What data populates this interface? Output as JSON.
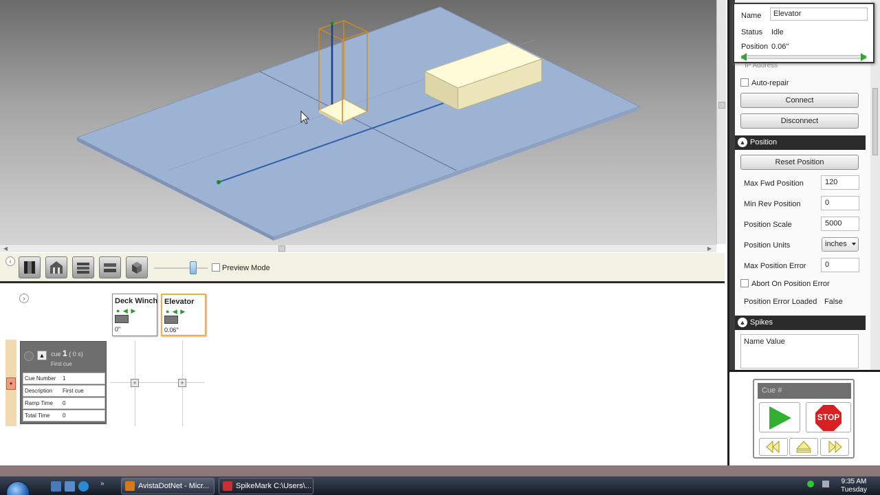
{
  "viewport": {
    "cursor": "arrow-cursor"
  },
  "toolbar": {
    "buttons": [
      "curtain-view-button",
      "house-view-button",
      "stack-view-button",
      "stack-alt-view-button",
      "iso-view-button"
    ],
    "preview_mode_label": "Preview Mode",
    "preview_mode_checked": false
  },
  "axes": [
    {
      "name": "Deck Winch",
      "value": "0\""
    },
    {
      "name": "Elevator",
      "value": "0.06\""
    }
  ],
  "cue": {
    "header_prefix": "cue",
    "number": "1",
    "time": "( 0 s)",
    "subtitle": "First cue",
    "fields": [
      {
        "label": "Cue Number",
        "value": "1"
      },
      {
        "label": "Description",
        "value": "First cue"
      },
      {
        "label": "Ramp Time",
        "value": "0"
      },
      {
        "label": "Total Time",
        "value": "0"
      }
    ]
  },
  "popup": {
    "name_label": "Name",
    "name_value": "Elevator",
    "status_label": "Status",
    "status_value": "Idle",
    "position_label": "Position",
    "position_value": "0.06\""
  },
  "props": {
    "ip_label": "IP Address",
    "auto_repair_label": "Auto-repair",
    "connect_label": "Connect",
    "disconnect_label": "Disconnect",
    "position_section": "Position",
    "reset_position_label": "Reset Position",
    "max_fwd_label": "Max Fwd Position",
    "max_fwd_value": "120",
    "min_rev_label": "Min Rev Position",
    "min_rev_value": "0",
    "scale_label": "Position Scale",
    "scale_value": "5000",
    "units_label": "Position Units",
    "units_value": "inches",
    "max_err_label": "Max Position Error",
    "max_err_value": "0",
    "abort_label": "Abort On Position Error",
    "err_loaded_label": "Position Error Loaded",
    "err_loaded_value": "False",
    "spikes_section": "Spikes",
    "spikes_col": "Name Value"
  },
  "transport": {
    "cue_placeholder": "Cue #",
    "stop_label": "STOP"
  },
  "taskbar": {
    "tasks": [
      "AvistaDotNet - Micr...",
      "SpikeMark C:\\Users\\..."
    ],
    "time": "9:35 AM",
    "day": "Tuesday"
  },
  "colors": {
    "accent_orange": "#f0b040",
    "go_green": "#32b032",
    "stop_red": "#d82020",
    "floor_blue": "#9db3d4"
  }
}
